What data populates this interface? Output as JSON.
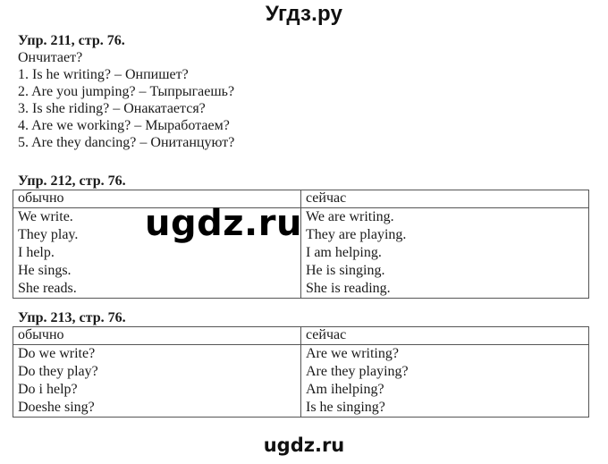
{
  "site_title": "Угдз.ру",
  "exercises": {
    "ex211": {
      "heading": "Упр. 211, стр. 76.",
      "lines": [
        "Ончитает?",
        "1. Is he writing? – Онпишет?",
        "2. Are you jumping? – Тыпрыгаешь?",
        "3. Is she riding? – Онакатается?",
        "4. Are we working? – Мыработаем?",
        "5. Are they dancing? – Онитанцуют?"
      ]
    },
    "ex212": {
      "heading": "Упр. 212, стр. 76.",
      "columns": [
        "обычно",
        "сейчас"
      ],
      "left": [
        "We write.",
        "They play.",
        "I help.",
        "He sings.",
        "She reads."
      ],
      "right": [
        "We are writing.",
        "They are playing.",
        "I am helping.",
        "He is singing.",
        "She is reading."
      ]
    },
    "ex213": {
      "heading": "Упр. 213, стр. 76.",
      "columns": [
        "обычно",
        "сейчас"
      ],
      "left": [
        "Do we write?",
        "Do they play?",
        "Do i help?",
        "Doeshe sing?"
      ],
      "right": [
        "Are we writing?",
        "Are they playing?",
        "Am ihelping?",
        "Is he singing?"
      ]
    }
  },
  "watermark": "ugdz.ru",
  "footer_watermark": "ugdz.ru"
}
